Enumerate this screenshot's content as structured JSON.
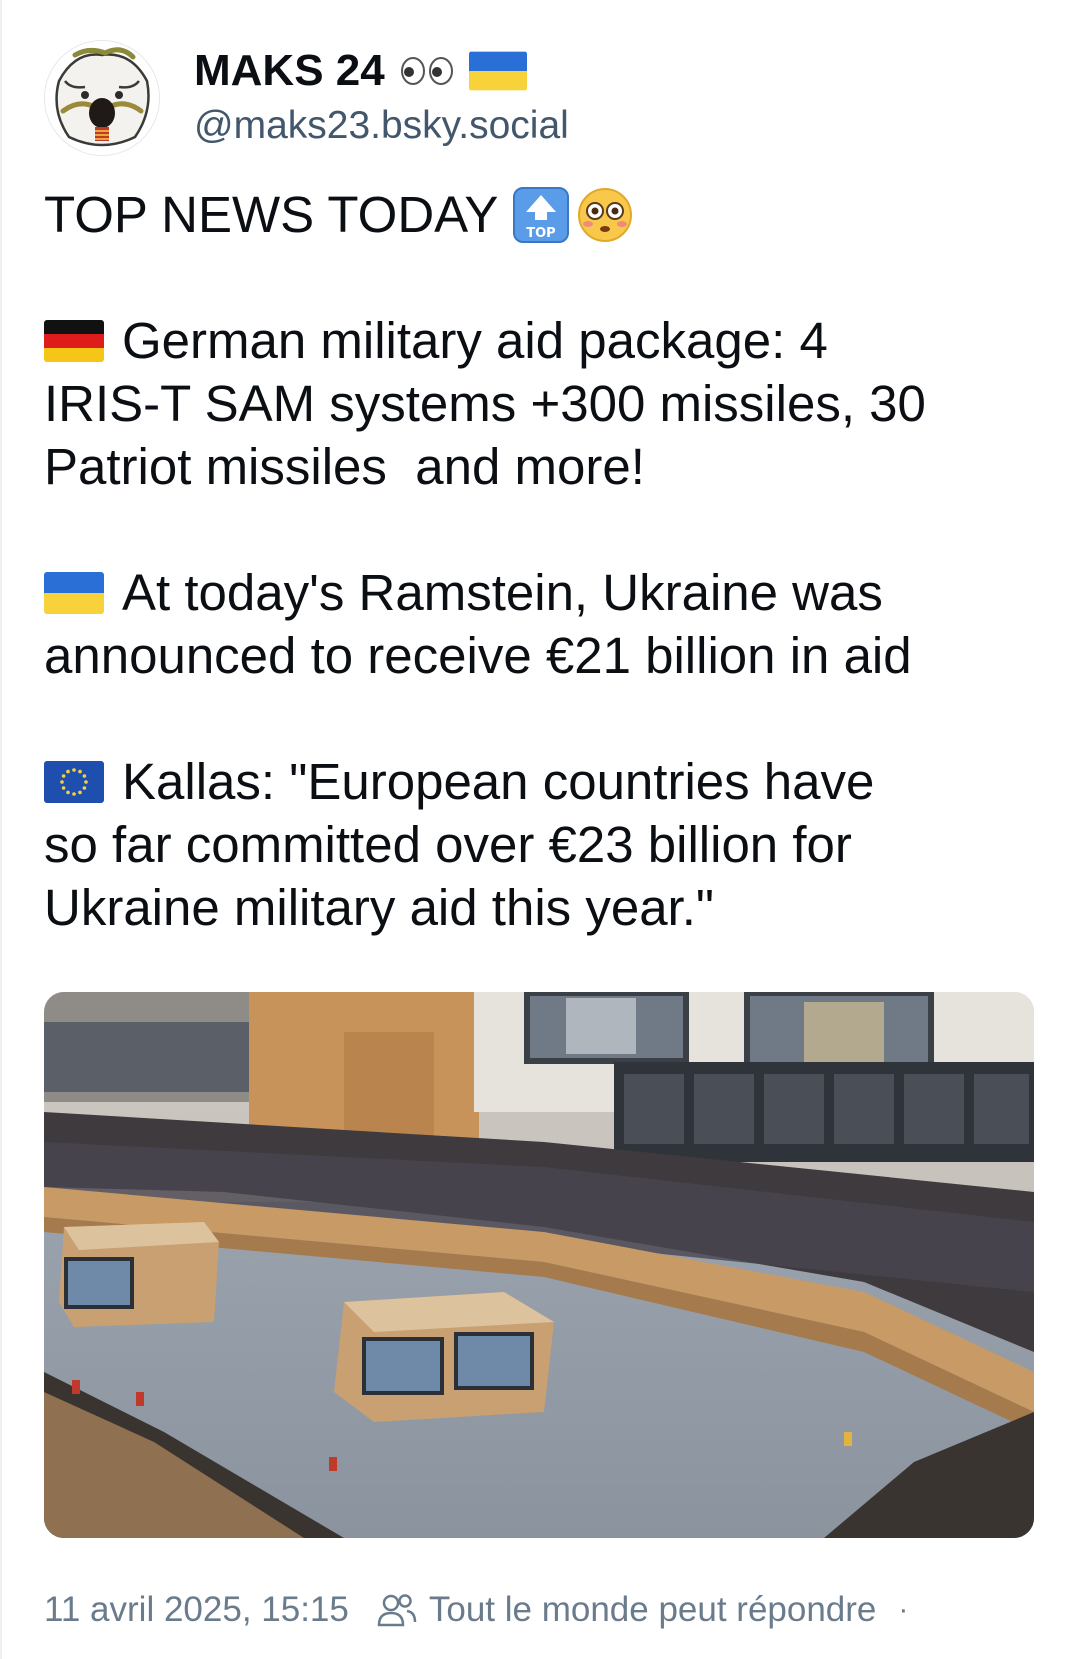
{
  "author": {
    "display_name": "MAKS 24",
    "handle": "@maks23.bsky.social",
    "name_emojis": [
      "eyes-icon",
      "ukraine-flag-icon"
    ]
  },
  "post": {
    "lines": [
      "TOP NEWS TODAY",
      "German military aid package: 4",
      "IRIS-T SAM systems +300 missiles, 30",
      "Patriot missiles  and more!",
      "At today's Ramstein, Ukraine was",
      "announced to receive €21 billion in aid",
      "Kallas: \"European countries have",
      "so far committed over €23 billion for",
      "Ukraine military aid this year.\""
    ],
    "emojis": {
      "headline": [
        "top-arrow-icon",
        "flushed-face-icon"
      ],
      "paragraph_1": "germany-flag-icon",
      "paragraph_2": "ukraine-flag-icon",
      "paragraph_3": "eu-flag-icon"
    }
  },
  "media": {
    "type": "photo",
    "subject": "meeting-hall-photo"
  },
  "meta": {
    "timestamp": "11 avril 2025, 15:15",
    "reply_setting": "Tout le monde peut répondre",
    "separator": "·"
  },
  "colors": {
    "text": "#0b0f14",
    "secondary": "#42576c",
    "muted": "#6a7b8c",
    "background": "#ffffff"
  }
}
